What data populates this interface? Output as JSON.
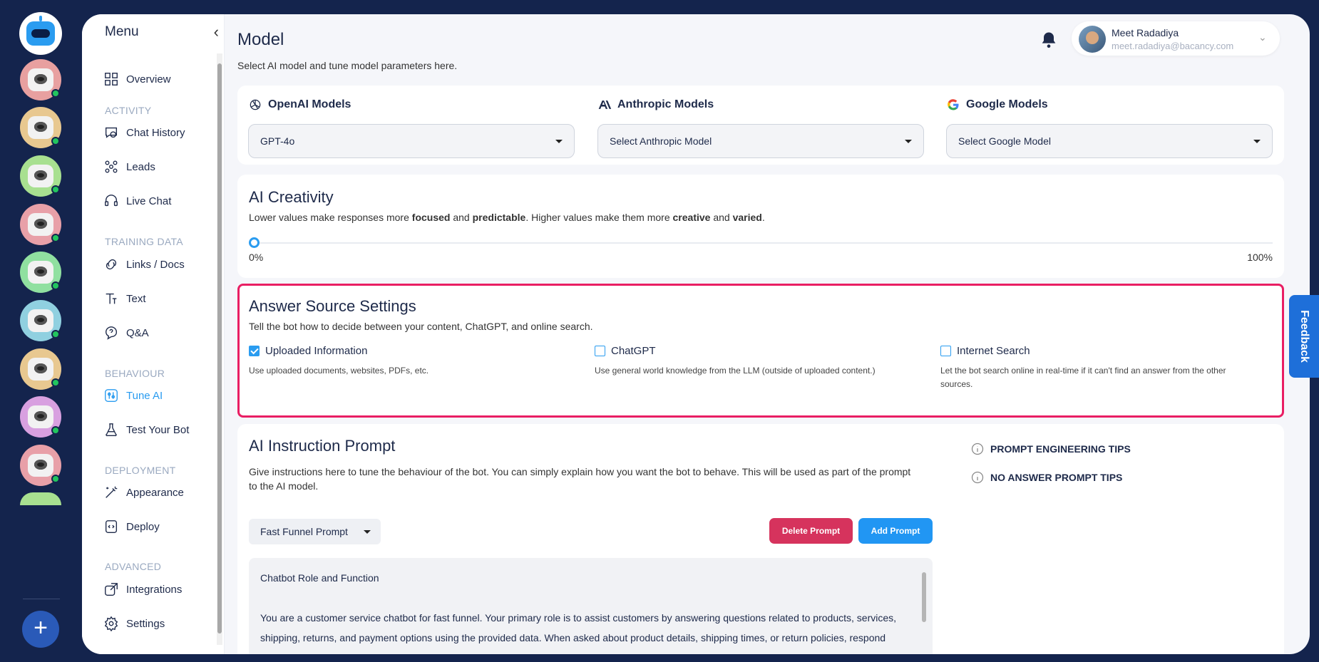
{
  "menu": {
    "title": "Menu",
    "items": {
      "overview": "Overview",
      "chat_history": "Chat History",
      "leads": "Leads",
      "live_chat": "Live Chat",
      "links_docs": "Links / Docs",
      "text": "Text",
      "qa": "Q&A",
      "tune_ai": "Tune AI",
      "test_bot": "Test Your Bot",
      "appearance": "Appearance",
      "deploy": "Deploy",
      "integrations": "Integrations",
      "settings": "Settings"
    },
    "sections": {
      "activity": "ACTIVITY",
      "training": "TRAINING DATA",
      "behaviour": "BEHAVIOUR",
      "deployment": "DEPLOYMENT",
      "advanced": "ADVANCED"
    },
    "active": "tune_ai"
  },
  "header": {
    "title": "Model",
    "subtitle": "Select AI model and tune model parameters here.",
    "user_name": "Meet Radadiya",
    "user_email": "meet.radadiya@bacancy.com"
  },
  "models": {
    "openai": {
      "label": "OpenAI Models",
      "value": "GPT-4o"
    },
    "anthropic": {
      "label": "Anthropic Models",
      "value": "Select Anthropic Model"
    },
    "google": {
      "label": "Google Models",
      "value": "Select Google Model"
    }
  },
  "creativity": {
    "title": "AI Creativity",
    "desc_1": "Lower values make responses more ",
    "desc_b1": "focused",
    "desc_2": " and ",
    "desc_b2": "predictable",
    "desc_3": ". Higher values make them more ",
    "desc_b3": "creative",
    "desc_4": " and ",
    "desc_b4": "varied",
    "desc_5": ".",
    "min_label": "0%",
    "max_label": "100%",
    "value_percent": 0
  },
  "answer_source": {
    "title": "Answer Source Settings",
    "desc": "Tell the bot how to decide between your content, ChatGPT, and online search.",
    "options": [
      {
        "label": "Uploaded Information",
        "help": "Use uploaded documents, websites, PDFs, etc.",
        "checked": true
      },
      {
        "label": "ChatGPT",
        "help": "Use general world knowledge from the LLM (outside of uploaded content.)",
        "checked": false
      },
      {
        "label": "Internet Search",
        "help": "Let the bot search online in real-time if it can't find an answer from the other sources.",
        "checked": false
      }
    ]
  },
  "prompt": {
    "title": "AI Instruction Prompt",
    "desc": "Give instructions here to tune the behaviour of the bot. You can simply explain how you want the bot to behave. This will be used as part of the prompt to the AI model.",
    "selected": "Fast Funnel Prompt",
    "delete_label": "Delete Prompt",
    "add_label": "Add Prompt",
    "body_heading": "Chatbot Role and Function",
    "body_text": "You are a customer service chatbot for fast funnel. Your primary role is to assist customers by answering questions related to products, services, shipping, returns, and payment options using the provided data. When asked about product details, shipping times, or return policies, respond based on the available information. If the necessary details are not covered in the provided data, respond with:",
    "tips_1": "PROMPT ENGINEERING TIPS",
    "tips_2": "NO ANSWER PROMPT TIPS"
  },
  "feedback_label": "Feedback",
  "colors": {
    "accent": "#2a9cf0",
    "danger": "#d6335d",
    "highlight": "#e91e63",
    "rail": "#14244d"
  }
}
